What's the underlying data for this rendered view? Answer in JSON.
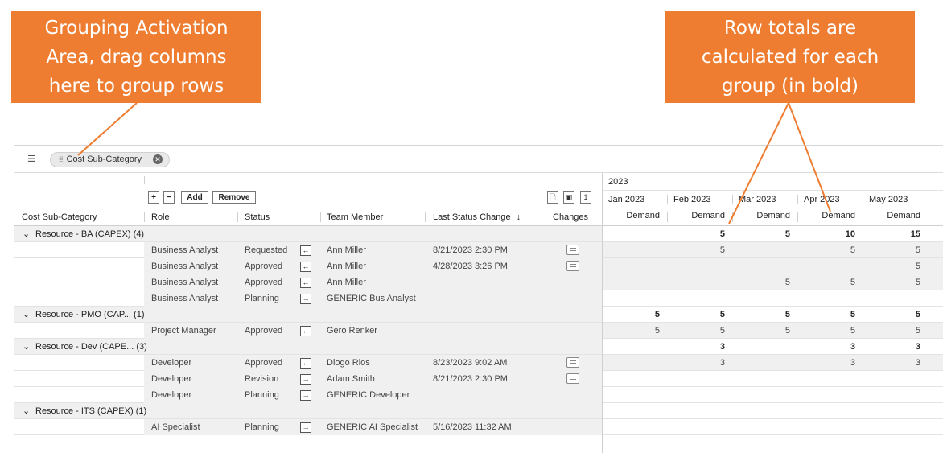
{
  "callouts": {
    "grouping": "Grouping Activation\nArea, drag columns\nhere to group rows",
    "totals": "Row totals are\ncalculated for each\ngroup (in bold)"
  },
  "group_bar": {
    "toggle_icon": "group-list-icon",
    "chip_label": "Cost Sub-Category",
    "chip_grip": "⁞⁞⁞",
    "chip_close": "✕"
  },
  "toolbar": {
    "expand": "+",
    "collapse": "−",
    "add": "Add",
    "remove": "Remove",
    "icon_doc": "🗋",
    "icon_img": "▣",
    "page_num": "1"
  },
  "columns": {
    "cost_sub_category": "Cost Sub-Category",
    "role": "Role",
    "status": "Status",
    "team_member": "Team Member",
    "last_status_change": "Last Status Change",
    "sort_icon": "↓",
    "changes": "Changes"
  },
  "timeline": {
    "year": "2023",
    "months": [
      "Jan 2023",
      "Feb 2023",
      "Mar 2023",
      "Apr 2023",
      "May 2023"
    ],
    "metric": "Demand"
  },
  "groups": [
    {
      "label": "Resource - BA (CAPEX) (4)",
      "totals": [
        "",
        "5",
        "5",
        "10",
        "15"
      ],
      "rows": [
        {
          "role": "Business Analyst",
          "status": "Requested",
          "dir": "←",
          "member": "Ann Miller",
          "changed": "8/21/2023 2:30 PM",
          "comment": true,
          "values": [
            "",
            "5",
            "",
            "5",
            "5"
          ]
        },
        {
          "role": "Business Analyst",
          "status": "Approved",
          "dir": "←",
          "member": "Ann Miller",
          "changed": "4/28/2023 3:26 PM",
          "comment": true,
          "values": [
            "",
            "",
            "",
            "",
            "5"
          ]
        },
        {
          "role": "Business Analyst",
          "status": "Approved",
          "dir": "←",
          "member": "Ann Miller",
          "changed": "",
          "comment": false,
          "values": [
            "",
            "",
            "5",
            "5",
            "5"
          ]
        },
        {
          "role": "Business Analyst",
          "status": "Planning",
          "dir": "→",
          "member": "GENERIC Bus Analyst",
          "changed": "",
          "comment": false,
          "values": [
            "",
            "",
            "",
            "",
            ""
          ]
        }
      ]
    },
    {
      "label": "Resource - PMO (CAP... (1)",
      "totals": [
        "5",
        "5",
        "5",
        "5",
        "5"
      ],
      "rows": [
        {
          "role": "Project Manager",
          "status": "Approved",
          "dir": "←",
          "member": "Gero Renker",
          "changed": "",
          "comment": false,
          "values": [
            "5",
            "5",
            "5",
            "5",
            "5"
          ]
        }
      ]
    },
    {
      "label": "Resource - Dev (CAPE... (3)",
      "totals": [
        "",
        "3",
        "",
        "3",
        "3"
      ],
      "rows": [
        {
          "role": "Developer",
          "status": "Approved",
          "dir": "←",
          "member": "Diogo Rios",
          "changed": "8/23/2023 9:02 AM",
          "comment": true,
          "values": [
            "",
            "3",
            "",
            "3",
            "3"
          ]
        },
        {
          "role": "Developer",
          "status": "Revision",
          "dir": "→",
          "member": "Adam Smith",
          "changed": "8/21/2023 2:30 PM",
          "comment": true,
          "values": [
            "",
            "",
            "",
            "",
            ""
          ]
        },
        {
          "role": "Developer",
          "status": "Planning",
          "dir": "→",
          "member": "GENERIC Developer",
          "changed": "",
          "comment": false,
          "values": [
            "",
            "",
            "",
            "",
            ""
          ]
        }
      ]
    },
    {
      "label": "Resource - ITS (CAPEX) (1)",
      "totals": [
        "",
        "",
        "",
        "",
        ""
      ],
      "rows": [
        {
          "role": "AI Specialist",
          "status": "Planning",
          "dir": "→",
          "member": "GENERIC AI Specialist",
          "changed": "5/16/2023 11:32 AM",
          "comment": false,
          "values": [
            "",
            "",
            "",
            "",
            ""
          ]
        }
      ]
    }
  ],
  "colors": {
    "callout": "#ee7d31",
    "group_row": "#f0f0f0"
  }
}
